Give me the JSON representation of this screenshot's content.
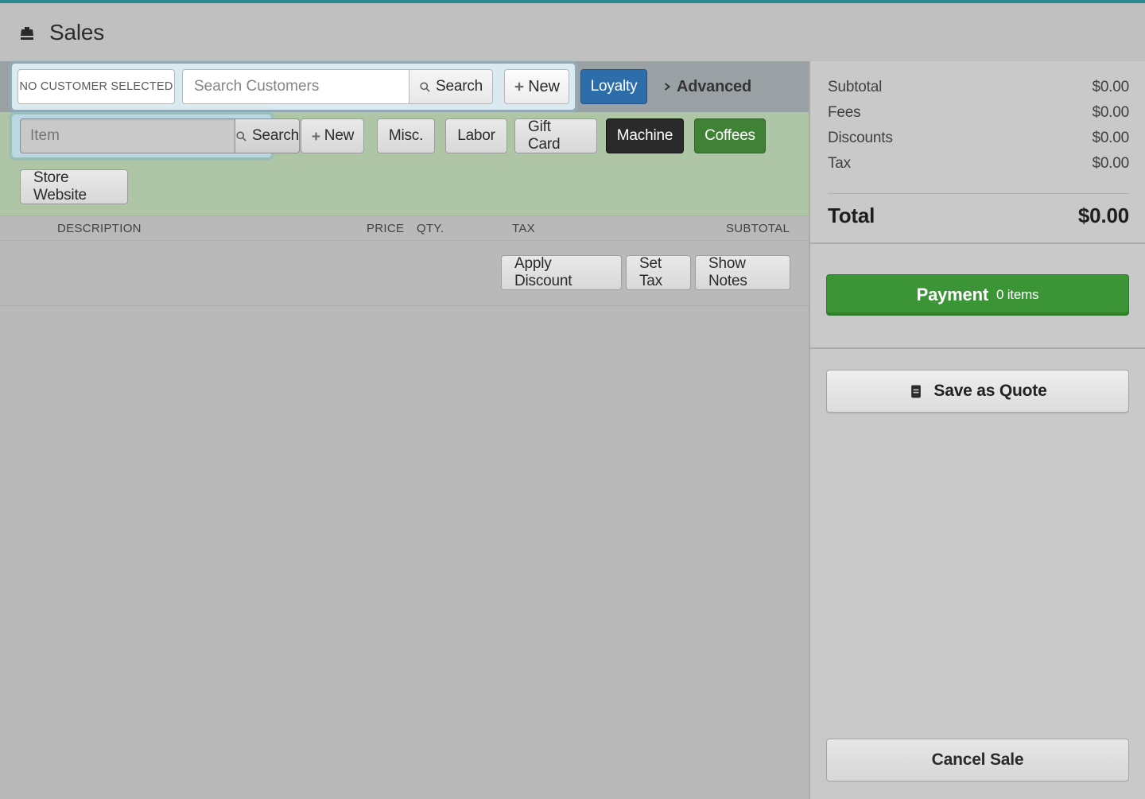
{
  "header": {
    "title": "Sales"
  },
  "customer": {
    "no_customer_label": "NO CUSTOMER SELECTED",
    "search_placeholder": "Search Customers",
    "search_button": "Search",
    "new_button": "New",
    "loyalty_button": "Loyalty",
    "advanced_button": "Advanced"
  },
  "item_bar": {
    "item_placeholder": "Item",
    "search_button": "Search",
    "buttons": {
      "new": "New",
      "misc": "Misc.",
      "labor": "Labor",
      "gift_card": "Gift Card",
      "machine": "Machine",
      "coffees": "Coffees",
      "store_website": "Store Website"
    }
  },
  "columns": {
    "description": "Description",
    "price": "Price",
    "qty": "Qty.",
    "tax": "Tax",
    "subtotal": "Subtotal"
  },
  "line_actions": {
    "apply_discount": "Apply Discount",
    "set_tax": "Set Tax",
    "show_notes": "Show Notes"
  },
  "totals": {
    "subtotal_label": "Subtotal",
    "subtotal_value": "$0.00",
    "fees_label": "Fees",
    "fees_value": "$0.00",
    "discounts_label": "Discounts",
    "discounts_value": "$0.00",
    "tax_label": "Tax",
    "tax_value": "$0.00",
    "total_label": "Total",
    "total_value": "$0.00"
  },
  "sidebar_actions": {
    "payment_label": "Payment",
    "payment_items": "0 items",
    "save_quote": "Save as Quote",
    "cancel_sale": "Cancel Sale"
  }
}
